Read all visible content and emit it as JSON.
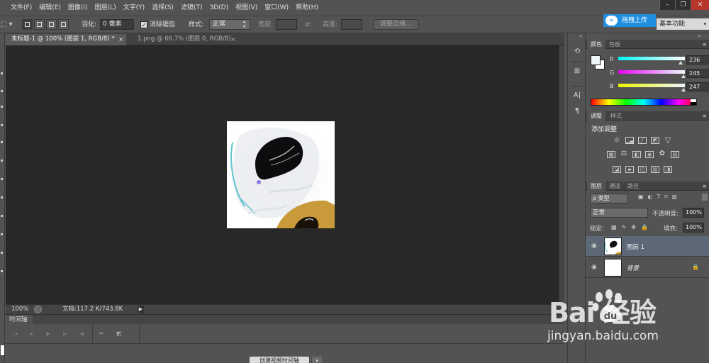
{
  "menubar": {
    "items": [
      "文件(F)",
      "编辑(E)",
      "图像(I)",
      "图层(L)",
      "文字(Y)",
      "选择(S)",
      "滤镜(T)",
      "3D(D)",
      "视图(V)",
      "窗口(W)",
      "帮助(H)"
    ]
  },
  "window_controls": {
    "minimize": "–",
    "maximize": "❐",
    "close": "✕"
  },
  "options": {
    "feather_label": "羽化:",
    "feather_value": "0 像素",
    "antialias_label": "消除锯齿",
    "style_label": "样式:",
    "style_value": "正常",
    "width_label": "宽度:",
    "height_label": "高度:",
    "refine_edge_label": "调整边缘...",
    "upload_label": "拖拽上传",
    "workspace_value": "基本功能"
  },
  "doc_tabs": [
    {
      "label": "未标题-1 @ 100% (图层 1, RGB/8) *",
      "close": "×"
    },
    {
      "label": "1.png @ 66.7% (图层 0, RGB/8)",
      "close": "×"
    }
  ],
  "status": {
    "zoom": "100%",
    "doc_info": "文档:117.2 K/743.8K",
    "arrow": "▶"
  },
  "timeline": {
    "tab_label": "时间轴",
    "create_button": "创建视频时间轴",
    "dropdown": "▾"
  },
  "color_panel": {
    "tabs": [
      "颜色",
      "色板"
    ],
    "sliders": [
      {
        "letter": "R",
        "value": "236"
      },
      {
        "letter": "G",
        "value": "245"
      },
      {
        "letter": "B",
        "value": "247"
      }
    ],
    "fg_color": "#ecf5f7",
    "bg_color": "#ffffff"
  },
  "adjust_panel": {
    "tabs": [
      "调整",
      "样式"
    ],
    "title": "添加调整"
  },
  "layers_panel": {
    "tabs": [
      "图层",
      "通道",
      "路径"
    ],
    "filter_value": "ρ 类型",
    "blend_mode": "正常",
    "opacity_label": "不透明度:",
    "opacity_value": "100%",
    "lock_label": "锁定:",
    "fill_label": "填充:",
    "fill_value": "100%",
    "layers": [
      {
        "name": "图层 1",
        "selected": true
      },
      {
        "name": "背景",
        "selected": false
      }
    ]
  },
  "watermark": {
    "brand": "Bai  经验",
    "url": "jingyan.baidu.com"
  },
  "colors": {
    "accent": "#1f8fe0",
    "canvas_bg": "#282828",
    "panel_bg": "#535353",
    "selected_layer": "#5c6876"
  }
}
